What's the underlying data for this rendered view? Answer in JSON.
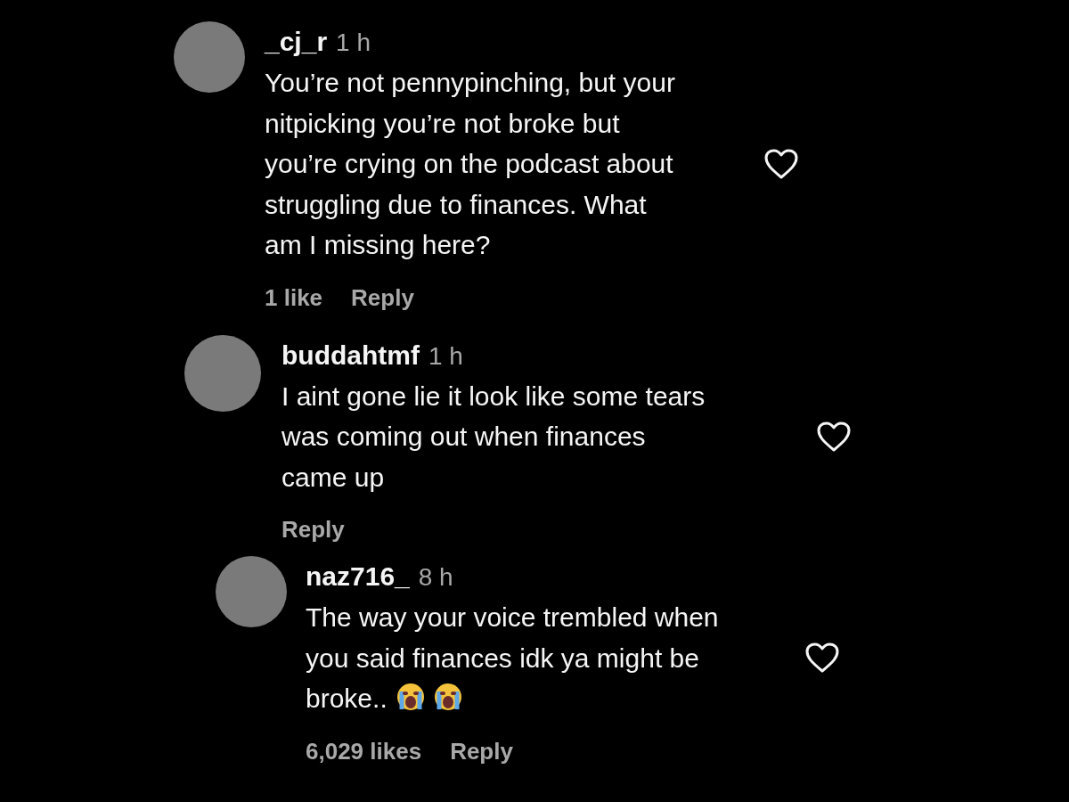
{
  "comments": [
    {
      "username": "_cj_r",
      "time": "1 h",
      "lines": [
        "You’re not pennypinching, but your",
        "nitpicking you’re not broke but",
        "you’re crying on the podcast about",
        "struggling due to finances. What",
        "am I missing here?"
      ],
      "likes": "1 like",
      "reply": "Reply",
      "liked": false,
      "replies": [
        {
          "username": "buddahtmf",
          "time": "1 h",
          "lines": [
            "I aint gone lie it look like some tears",
            "was coming out when finances",
            "came up"
          ],
          "reply": "Reply",
          "liked": false,
          "replies": [
            {
              "username": "naz716_",
              "time": "8 h",
              "lines": [
                "The way your voice trembled when",
                "you said finances idk ya might be",
                "broke.."
              ],
              "likes": "6,029 likes",
              "reply": "Reply",
              "liked": false
            }
          ]
        }
      ]
    }
  ]
}
